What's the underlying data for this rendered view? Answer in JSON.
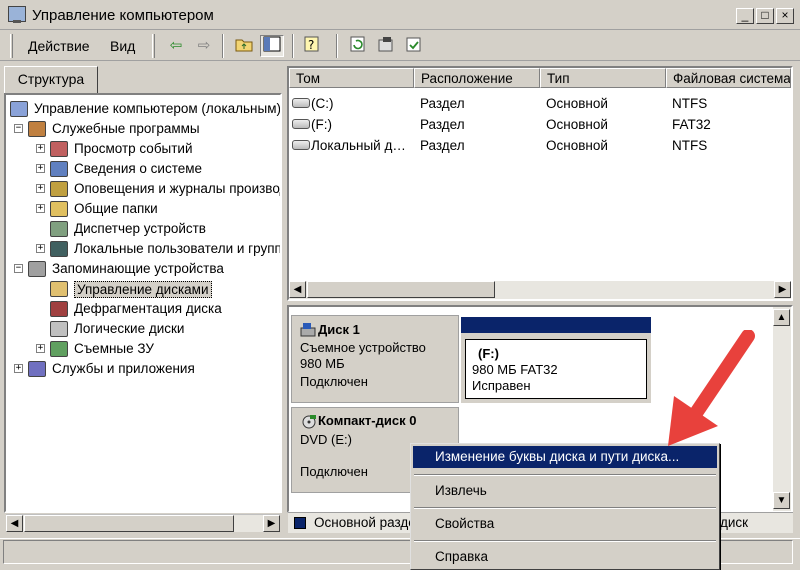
{
  "window": {
    "title": "Управление компьютером",
    "controls": {
      "minimize": "_",
      "maximize": "□",
      "close": "×"
    }
  },
  "menubar": {
    "items": [
      "Действие",
      "Вид"
    ]
  },
  "toolbar": {
    "icons": [
      "back-arrow-icon",
      "forward-arrow-icon",
      "up-folder-icon",
      "show-hide-tree-icon",
      "help-icon",
      "refresh-icon",
      "properties-icon",
      "export-icon"
    ]
  },
  "left_pane": {
    "tab_label": "Структура",
    "tree": [
      {
        "label": "Управление компьютером (локальным)",
        "level": 0,
        "expander": ""
      },
      {
        "label": "Служебные программы",
        "level": 1,
        "expander": "−"
      },
      {
        "label": "Просмотр событий",
        "level": 2,
        "expander": "+"
      },
      {
        "label": "Сведения о системе",
        "level": 2,
        "expander": "+"
      },
      {
        "label": "Оповещения и журналы производительности",
        "level": 2,
        "expander": "+"
      },
      {
        "label": "Общие папки",
        "level": 2,
        "expander": "+"
      },
      {
        "label": "Диспетчер устройств",
        "level": 2,
        "expander": ""
      },
      {
        "label": "Локальные пользователи и группы",
        "level": 2,
        "expander": "+"
      },
      {
        "label": "Запоминающие устройства",
        "level": 1,
        "expander": "−"
      },
      {
        "label": "Управление дисками",
        "level": 2,
        "expander": "",
        "selected": true
      },
      {
        "label": "Дефрагментация диска",
        "level": 2,
        "expander": ""
      },
      {
        "label": "Логические диски",
        "level": 2,
        "expander": ""
      },
      {
        "label": "Съемные ЗУ",
        "level": 2,
        "expander": "+"
      },
      {
        "label": "Службы и приложения",
        "level": 1,
        "expander": "+"
      }
    ]
  },
  "volume_list": {
    "columns": [
      "Том",
      "Расположение",
      "Тип",
      "Файловая система"
    ],
    "rows": [
      {
        "volume": "(C:)",
        "location": "Раздел",
        "type": "Основной",
        "fs": "NTFS"
      },
      {
        "volume": "(F:)",
        "location": "Раздел",
        "type": "Основной",
        "fs": "FAT32"
      },
      {
        "volume": "Локальный диск",
        "location": "Раздел",
        "type": "Основной",
        "fs": "NTFS"
      }
    ]
  },
  "disks": [
    {
      "name": "Диск 1",
      "kind": "Съемное устройство",
      "size": "980 МБ",
      "status": "Подключен",
      "partition": {
        "letter": "(F:)",
        "info": "980 МБ FAT32",
        "status": "Исправен"
      }
    },
    {
      "name": "Компакт-диск 0",
      "kind": "DVD (E:)",
      "size": "",
      "status": "Подключен"
    }
  ],
  "legend": {
    "label": "Основной раздел",
    "label_right": "диск",
    "primary_color": "#0a246a"
  },
  "context_menu": {
    "items": [
      {
        "label": "Изменение буквы диска и пути диска...",
        "highlighted": true
      },
      {
        "label": "Извлечь"
      },
      {
        "label": "Свойства"
      },
      {
        "label": "Справка"
      }
    ]
  },
  "colors": {
    "face": "#d4d0c8",
    "selection": "#0a246a",
    "arrow": "#e8413c"
  }
}
